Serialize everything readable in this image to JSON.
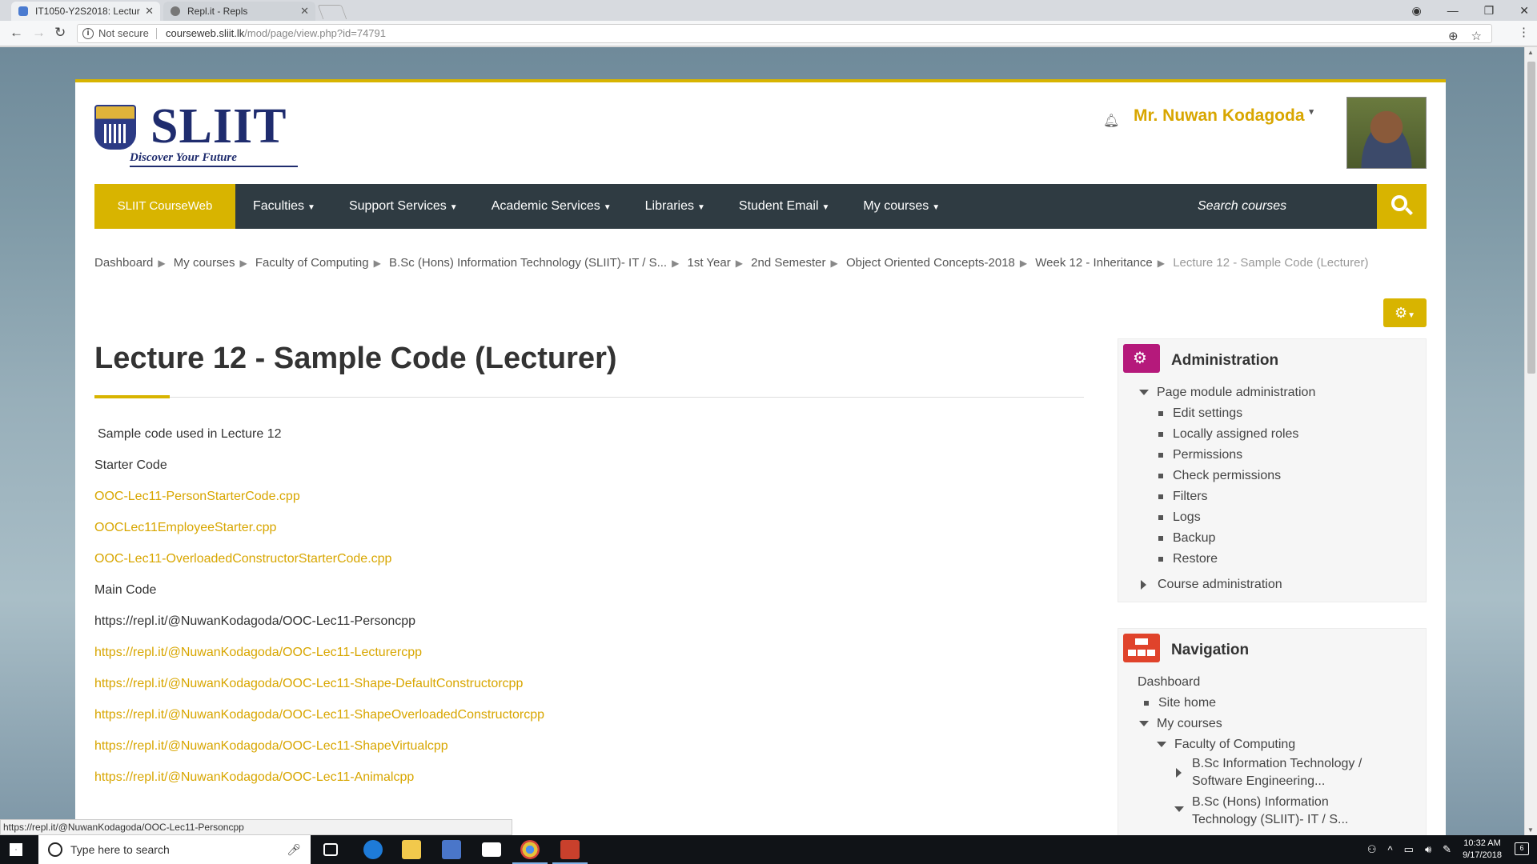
{
  "browser": {
    "tabs": [
      {
        "label": "IT1050-Y2S2018: Lectur",
        "close": "✕"
      },
      {
        "label": "Repl.it - Repls",
        "close": "✕"
      }
    ],
    "security_label": "Not secure",
    "url_host": "courseweb.sliit.lk",
    "url_path": "/mod/page/view.php?id=74791",
    "status_url": "https://repl.it/@NuwanKodagoda/OOC-Lec11-Personcpp"
  },
  "header": {
    "logo_text": "SLIIT",
    "logo_tagline": "Discover Your Future",
    "user_name": "Mr. Nuwan Kodagoda"
  },
  "nav": {
    "brand": "SLIIT CourseWeb",
    "menus": [
      "Faculties",
      "Support Services",
      "Academic Services",
      "Libraries",
      "Student Email",
      "My courses"
    ],
    "search_placeholder": "Search courses"
  },
  "breadcrumb": {
    "items": [
      "Dashboard",
      "My courses",
      "Faculty of Computing",
      "B.Sc (Hons) Information Technology (SLIIT)- IT / S...",
      "1st Year",
      "2nd Semester",
      "Object Oriented Concepts-2018",
      "Week 12 - Inheritance"
    ],
    "current": "Lecture 12 - Sample Code (Lecturer)"
  },
  "main": {
    "title": "Lecture 12 - Sample Code (Lecturer)",
    "intro": "Sample code used in Lecture 12",
    "starter_heading": "Starter Code",
    "starter_links": [
      "OOC-Lec11-PersonStarterCode.cpp",
      "OOCLec11EmployeeStarter.cpp",
      "OOC-Lec11-OverloadedConstructorStarterCode.cpp"
    ],
    "main_heading": "Main Code",
    "main_plain": "https://repl.it/@NuwanKodagoda/OOC-Lec11-Personcpp",
    "main_links": [
      "https://repl.it/@NuwanKodagoda/OOC-Lec11-Lecturercpp",
      "https://repl.it/@NuwanKodagoda/OOC-Lec11-Shape-DefaultConstructorcpp",
      "https://repl.it/@NuwanKodagoda/OOC-Lec11-ShapeOverloadedConstructorcpp",
      "https://repl.it/@NuwanKodagoda/OOC-Lec11-ShapeVirtualcpp",
      "https://repl.it/@NuwanKodagoda/OOC-Lec11-Animalcpp"
    ]
  },
  "administration": {
    "title": "Administration",
    "page_module": "Page module administration",
    "items": [
      "Edit settings",
      "Locally assigned roles",
      "Permissions",
      "Check permissions",
      "Filters",
      "Logs",
      "Backup",
      "Restore"
    ],
    "course_admin": "Course administration"
  },
  "navigation": {
    "title": "Navigation",
    "dashboard": "Dashboard",
    "site_home": "Site home",
    "my_courses": "My courses",
    "faculty": "Faculty of Computing",
    "course1_line1": "B.Sc Information Technology /",
    "course1_line2": "Software Engineering...",
    "course2_line1": "B.Sc (Hons) Information",
    "course2_line2": "Technology (SLIIT)- IT / S..."
  },
  "taskbar": {
    "search_placeholder": "Type here to search",
    "time": "10:32 AM",
    "date": "9/17/2018"
  },
  "colors": {
    "accent": "#d8b400",
    "navbar": "#2f3b42",
    "admin_icon": "#b5197b",
    "nav_icon": "#e0432b"
  }
}
